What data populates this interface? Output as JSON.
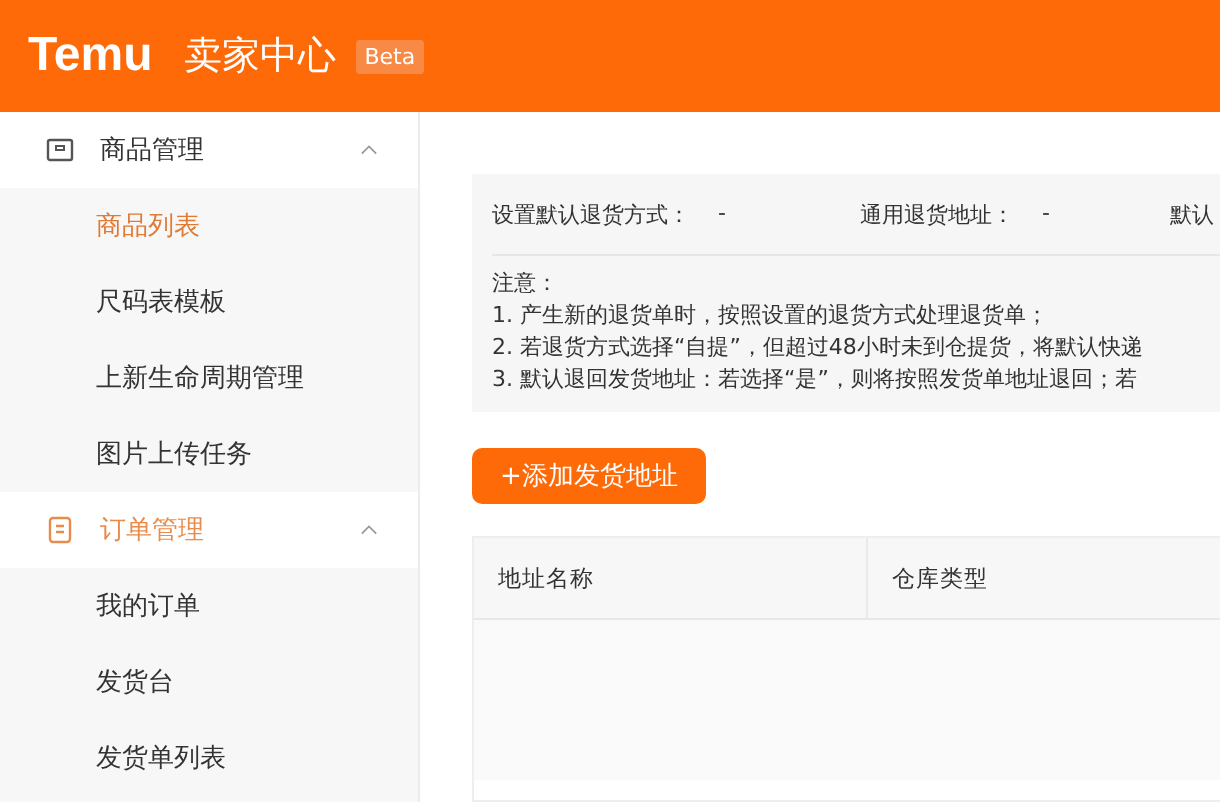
{
  "header": {
    "logo": "Temu",
    "title": "卖家中心",
    "badge": "Beta"
  },
  "sidebar": {
    "groups": [
      {
        "label": "商品管理",
        "expanded": true,
        "selected": false,
        "items": [
          {
            "label": "商品列表",
            "selected": true
          },
          {
            "label": "尺码表模板",
            "selected": false
          },
          {
            "label": "上新生命周期管理",
            "selected": false
          },
          {
            "label": "图片上传任务",
            "selected": false
          }
        ]
      },
      {
        "label": "订单管理",
        "expanded": true,
        "selected": true,
        "items": [
          {
            "label": "我的订单",
            "selected": false
          },
          {
            "label": "发货台",
            "selected": false
          },
          {
            "label": "发货单列表",
            "selected": false
          }
        ]
      }
    ]
  },
  "settings": {
    "fields": [
      {
        "label": "设置默认退货方式：",
        "value": "-"
      },
      {
        "label": "通用退货地址：",
        "value": "-"
      },
      {
        "label": "默认"
      }
    ],
    "notes": [
      "注意：",
      "1. 产生新的退货单时，按照设置的退货方式处理退货单；",
      "2. 若退货方式选择“自提”，但超过48小时未到仓提货，将默认快递",
      "3. 默认退回发货地址：若选择“是”，则将按照发货单地址退回；若"
    ]
  },
  "add_button": "+添加发货地址",
  "table": {
    "columns": [
      "地址名称",
      "仓库类型"
    ]
  }
}
